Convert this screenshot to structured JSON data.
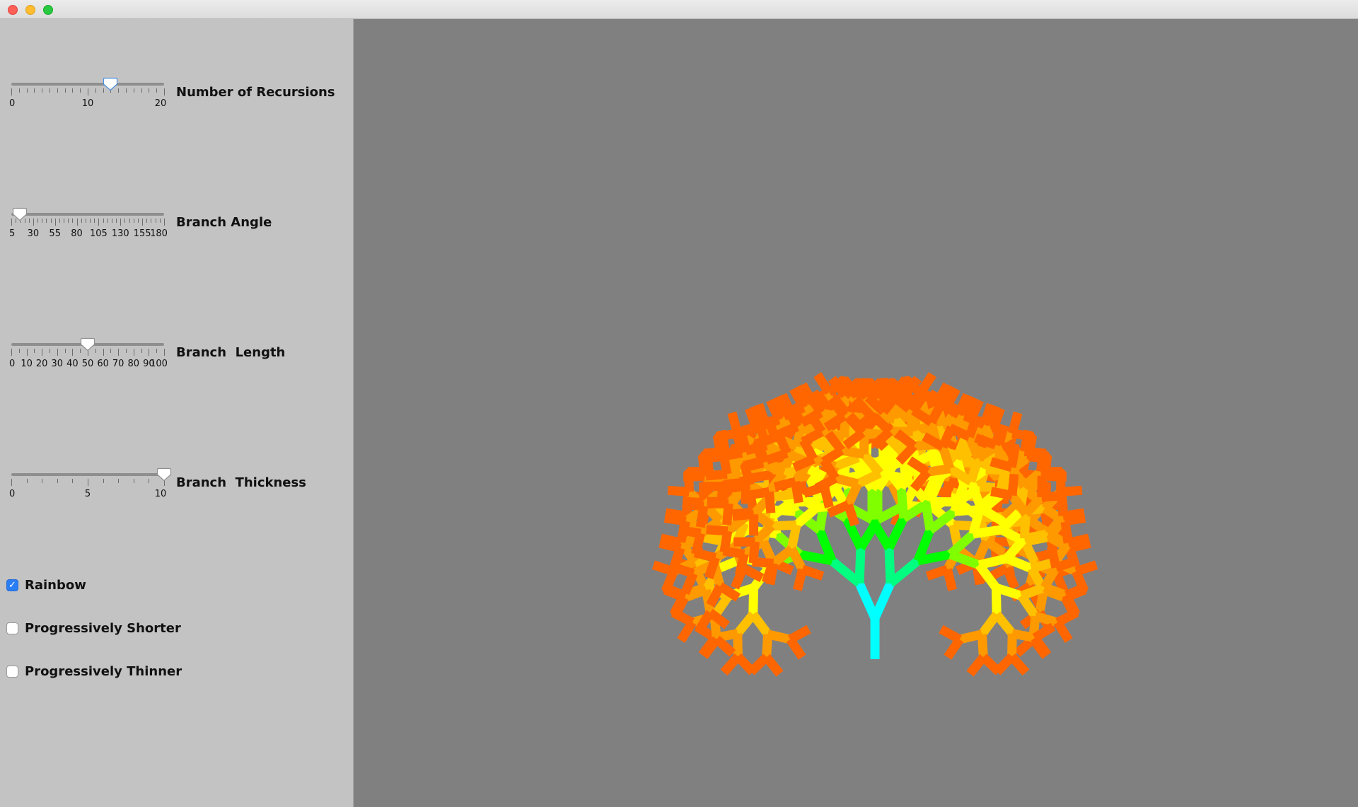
{
  "window": {
    "traffic_lights": {
      "close_color": "#fe5f57",
      "minimize_color": "#febc2e",
      "zoom_color": "#28c840"
    }
  },
  "controls": {
    "sliders": [
      {
        "label": "Number of Recursions",
        "min": 0,
        "max": 20,
        "value": 13,
        "minor_step": 1,
        "major_step": 10,
        "tick_labels": [
          "0",
          "10",
          "20"
        ],
        "thumb_style": "selected"
      },
      {
        "label": "Branch Angle",
        "min": 5,
        "max": 180,
        "value": 15,
        "minor_step": 5,
        "major_step": 25,
        "tick_labels": [
          "5",
          "30",
          "55",
          "80",
          "105",
          "130",
          "155",
          "180"
        ],
        "thumb_style": "normal"
      },
      {
        "label": "Branch  Length",
        "min": 0,
        "max": 100,
        "value": 50,
        "minor_step": 5,
        "major_step": 10,
        "tick_labels": [
          "0",
          "10",
          "20",
          "30",
          "40",
          "50",
          "60",
          "70",
          "80",
          "90",
          "100"
        ],
        "thumb_style": "normal"
      },
      {
        "label": "Branch  Thickness",
        "min": 0,
        "max": 10,
        "value": 10,
        "minor_step": 1,
        "major_step": 5,
        "tick_labels": [
          "0",
          "5",
          "10"
        ],
        "thumb_style": "normal"
      }
    ],
    "checkboxes": [
      {
        "label": "Rainbow",
        "checked": true
      },
      {
        "label": "Progressively Shorter",
        "checked": false
      },
      {
        "label": "Progressively Thinner",
        "checked": false
      }
    ]
  },
  "canvas": {
    "background": "#808080",
    "rainbow_colors": [
      "#00ffff",
      "#00ff80",
      "#00ff00",
      "#80ff00",
      "#ffff00",
      "#ffc000",
      "#ff9900",
      "#ff6600"
    ]
  }
}
